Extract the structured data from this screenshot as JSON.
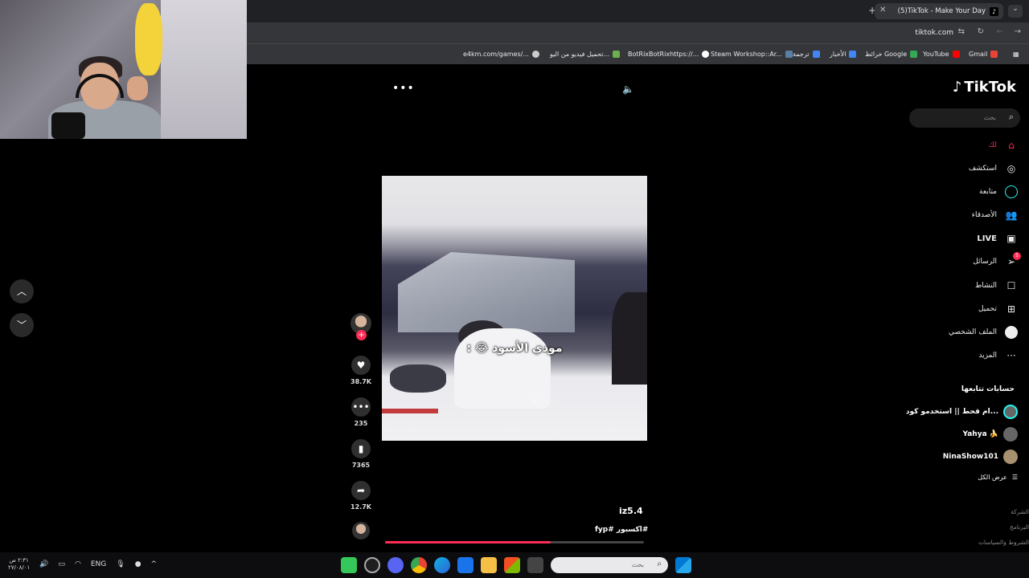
{
  "browser": {
    "tab_title": "(5)TikTok - Make Your Day",
    "url": "tiktok.com",
    "bookmarks": [
      {
        "label": "Gmail",
        "color": "#ea4335"
      },
      {
        "label": "YouTube",
        "color": "#ff0000"
      },
      {
        "label": "خرائط Google",
        "color": "#34a853"
      },
      {
        "label": "الأخبار",
        "color": "#4285f4"
      },
      {
        "label": "ترجمة",
        "color": "#4285f4"
      },
      {
        "label": "Steam Workshop::Ar...",
        "color": "#1b2838"
      },
      {
        "label": "BotRixBotRixhttps://...",
        "color": "#ffffff"
      },
      {
        "label": "تحميل فيديو من اليو...",
        "color": "#6ab04c"
      },
      {
        "label": "e4km.com/games/...",
        "color": "#cccccc"
      }
    ]
  },
  "video": {
    "caption": "مودي الأسود 😂 :",
    "username": "iz5.4",
    "hashtags": "#اكسبور #fyp",
    "progress": 0.64
  },
  "actions": {
    "likes": "38.7K",
    "comments": "235",
    "saves": "7365",
    "shares": "12.7K"
  },
  "sidebar": {
    "logo": "TikTok",
    "search_placeholder": "بحث",
    "nav": [
      {
        "label": "لك",
        "icon": "home-icon",
        "active": true
      },
      {
        "label": "استكشف",
        "icon": "compass-icon"
      },
      {
        "label": "متابعة",
        "icon": "following-icon"
      },
      {
        "label": "الأصدقاء",
        "icon": "friends-icon"
      },
      {
        "label": "LIVE",
        "icon": "live-icon"
      },
      {
        "label": "الرسائل",
        "icon": "messages-icon",
        "badge": "5"
      },
      {
        "label": "النشاط",
        "icon": "activity-icon"
      },
      {
        "label": "تحميل",
        "icon": "upload-icon"
      },
      {
        "label": "الملف الشخصي",
        "icon": "profile-icon"
      },
      {
        "label": "المزيد",
        "icon": "more-icon"
      }
    ],
    "following_title": "حسابات تتابعها",
    "following": [
      {
        "name": "ام قحط || استخدمو كود..."
      },
      {
        "name": "Yahya 🍌"
      },
      {
        "name": "NinaShow101"
      }
    ],
    "see_all": "عرض الكل",
    "footer": [
      "الشركة",
      "البرنامج",
      "الشروط والسياسات"
    ]
  },
  "taskbar": {
    "lang": "ENG",
    "time": "٢:٣١ ص",
    "date": "٢٧/٠٨/٠١",
    "search_placeholder": "بحث"
  }
}
